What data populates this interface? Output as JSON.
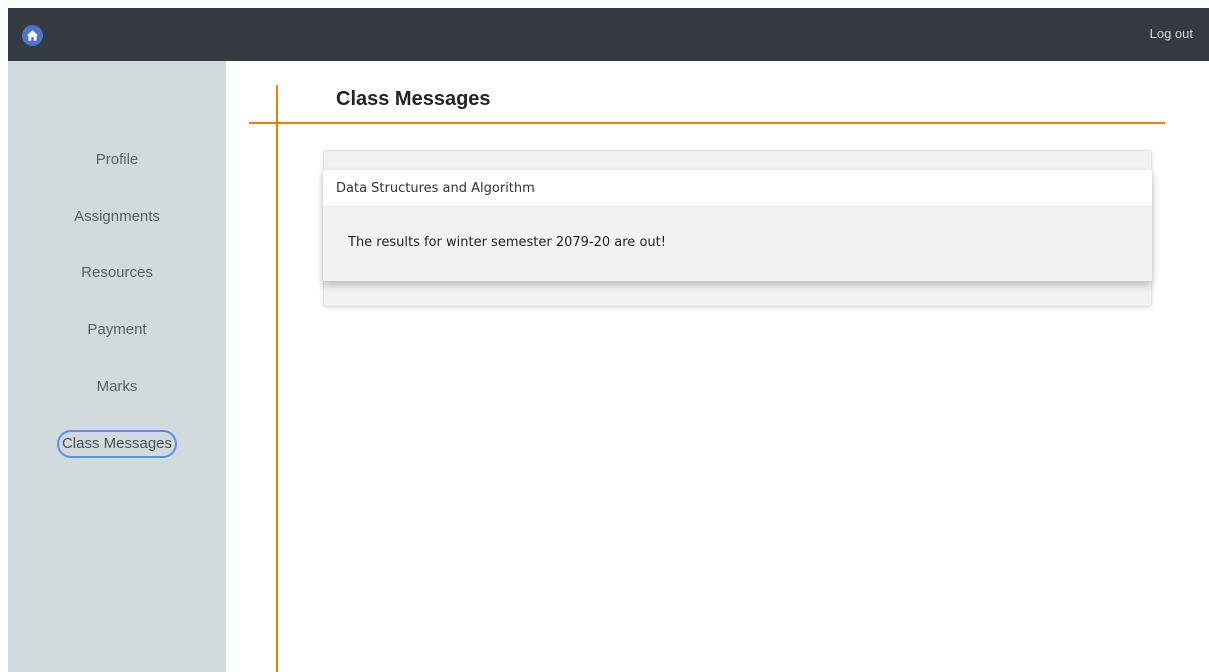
{
  "topbar": {
    "home_icon": "home-icon",
    "logout_label": "Log out",
    "background": "#343a40"
  },
  "sidebar": {
    "background": "#d1dbdd",
    "items": [
      {
        "label": "Profile"
      },
      {
        "label": "Assignments"
      },
      {
        "label": "Resources"
      },
      {
        "label": "Payment"
      },
      {
        "label": "Marks"
      },
      {
        "label": "Class Messages",
        "active": true
      }
    ]
  },
  "main": {
    "title": "Class Messages",
    "accent_color": "#f07c0c",
    "messages": [
      {
        "course": "Data Structures and Algorithm",
        "text": "The results for winter semester 2079-20 are out!"
      }
    ]
  }
}
